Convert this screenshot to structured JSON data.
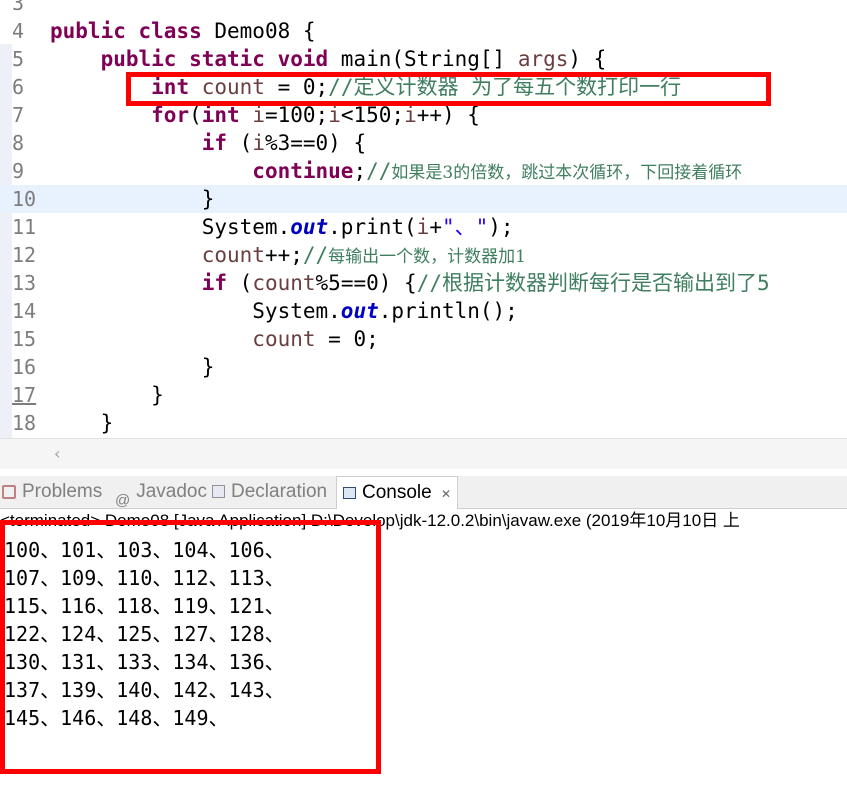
{
  "editor": {
    "lines": [
      {
        "num": "3"
      },
      {
        "num": "4",
        "parts": [
          {
            "t": "public class ",
            "k": "kw"
          },
          {
            "t": "Demo08 {"
          }
        ]
      },
      {
        "num": "5",
        "parts": [
          {
            "t": "    "
          },
          {
            "t": "public static void ",
            "k": "kw"
          },
          {
            "t": "main(String[] "
          },
          {
            "t": "args",
            "k": "var"
          },
          {
            "t": ") {"
          }
        ]
      },
      {
        "num": "6",
        "parts": [
          {
            "t": "        "
          },
          {
            "t": "int ",
            "k": "kw"
          },
          {
            "t": "count",
            "k": "var"
          },
          {
            "t": " = 0;"
          },
          {
            "t": "//定义计数器 为了每五个数打印一行",
            "k": "cmt"
          }
        ]
      },
      {
        "num": "7",
        "parts": [
          {
            "t": "        "
          },
          {
            "t": "for",
            "k": "kw"
          },
          {
            "t": "("
          },
          {
            "t": "int ",
            "k": "kw"
          },
          {
            "t": "i",
            "k": "var"
          },
          {
            "t": "=100;"
          },
          {
            "t": "i",
            "k": "var"
          },
          {
            "t": "<150;"
          },
          {
            "t": "i",
            "k": "var"
          },
          {
            "t": "++) {"
          }
        ]
      },
      {
        "num": "8",
        "parts": [
          {
            "t": "            "
          },
          {
            "t": "if ",
            "k": "kw"
          },
          {
            "t": "("
          },
          {
            "t": "i",
            "k": "var"
          },
          {
            "t": "%3==0) {"
          }
        ]
      },
      {
        "num": "9",
        "parts": [
          {
            "t": "                "
          },
          {
            "t": "continue",
            "k": "kw"
          },
          {
            "t": ";"
          },
          {
            "t": "//",
            "k": "cmt"
          },
          {
            "t": "如果是3的倍数，跳过本次循环，下回接着循环",
            "k": "cmtcjk"
          }
        ]
      },
      {
        "num": "10",
        "parts": [
          {
            "t": "            }"
          }
        ]
      },
      {
        "num": "11",
        "parts": [
          {
            "t": "            System."
          },
          {
            "t": "out",
            "k": "fld"
          },
          {
            "t": ".print("
          },
          {
            "t": "i",
            "k": "var"
          },
          {
            "t": "+"
          },
          {
            "t": "\"、\"",
            "k": "str"
          },
          {
            "t": ");"
          }
        ]
      },
      {
        "num": "12",
        "parts": [
          {
            "t": "            "
          },
          {
            "t": "count",
            "k": "var"
          },
          {
            "t": "++;"
          },
          {
            "t": "//",
            "k": "cmt"
          },
          {
            "t": "每输出一个数，计数器加1",
            "k": "cmtcjk"
          }
        ]
      },
      {
        "num": "13",
        "parts": [
          {
            "t": "            "
          },
          {
            "t": "if ",
            "k": "kw"
          },
          {
            "t": "("
          },
          {
            "t": "count",
            "k": "var"
          },
          {
            "t": "%5==0) {"
          },
          {
            "t": "//根据计数器判断每行是否输出到了5",
            "k": "cmt"
          }
        ]
      },
      {
        "num": "14",
        "parts": [
          {
            "t": "                System."
          },
          {
            "t": "out",
            "k": "fld"
          },
          {
            "t": ".println();"
          }
        ]
      },
      {
        "num": "15",
        "parts": [
          {
            "t": "                "
          },
          {
            "t": "count",
            "k": "var"
          },
          {
            "t": " = 0;"
          }
        ]
      },
      {
        "num": "16",
        "parts": [
          {
            "t": "            }"
          }
        ]
      },
      {
        "num": "17",
        "parts": [
          {
            "t": "        }"
          }
        ]
      },
      {
        "num": "18",
        "parts": [
          {
            "t": "    }"
          }
        ]
      }
    ]
  },
  "tabs": [
    {
      "label": "Problems",
      "icon": "problems-icon"
    },
    {
      "label": "Javadoc",
      "icon": "at-icon"
    },
    {
      "label": "Declaration",
      "icon": "declaration-icon"
    },
    {
      "label": "Console",
      "icon": "console-icon",
      "close": "✕"
    }
  ],
  "console": {
    "status": "<terminated> Demo08 [Java Application] D:\\Develop\\jdk-12.0.2\\bin\\javaw.exe (2019年10月10日 上",
    "output": [
      "100、101、103、104、106、",
      "107、109、110、112、113、",
      "115、116、118、119、121、",
      "122、124、125、127、128、",
      "130、131、133、134、136、",
      "137、139、140、142、143、",
      "145、146、148、149、"
    ]
  },
  "colors": {
    "keyword": "#7f0055",
    "comment": "#3f7f5f",
    "highlight": "#ff0000"
  }
}
